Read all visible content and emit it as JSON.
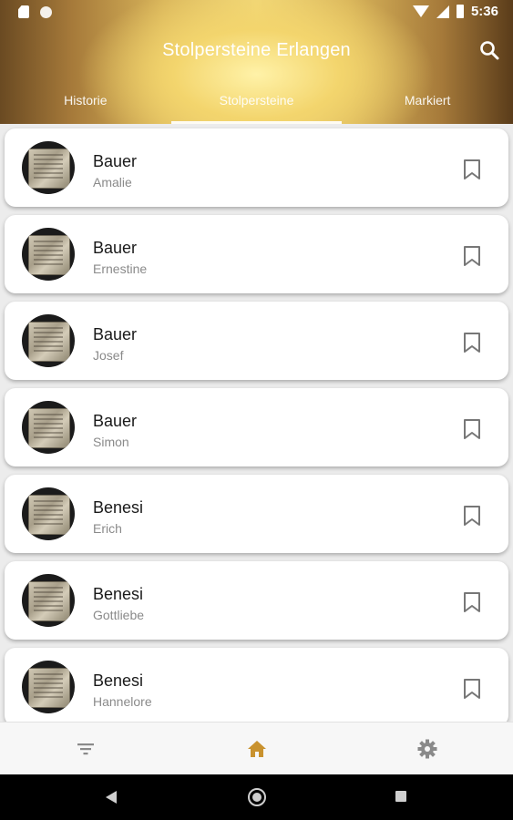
{
  "status_bar": {
    "time": "5:36"
  },
  "app": {
    "title": "Stolpersteine Erlangen"
  },
  "tabs": [
    {
      "label": "Historie",
      "active": false
    },
    {
      "label": "Stolpersteine",
      "active": true
    },
    {
      "label": "Markiert",
      "active": false
    }
  ],
  "entries": [
    {
      "surname": "Bauer",
      "firstname": "Amalie"
    },
    {
      "surname": "Bauer",
      "firstname": "Ernestine"
    },
    {
      "surname": "Bauer",
      "firstname": "Josef"
    },
    {
      "surname": "Bauer",
      "firstname": "Simon"
    },
    {
      "surname": "Benesi",
      "firstname": "Erich"
    },
    {
      "surname": "Benesi",
      "firstname": "Gottliebe"
    },
    {
      "surname": "Benesi",
      "firstname": "Hannelore"
    }
  ],
  "bottom_nav": {
    "items": [
      {
        "icon": "filter-icon",
        "active": false
      },
      {
        "icon": "home-icon",
        "active": true
      },
      {
        "icon": "gear-icon",
        "active": false
      }
    ]
  },
  "colors": {
    "accent": "#c9922e",
    "icon_inactive": "#8a8a8a",
    "bookmark": "#777777"
  }
}
